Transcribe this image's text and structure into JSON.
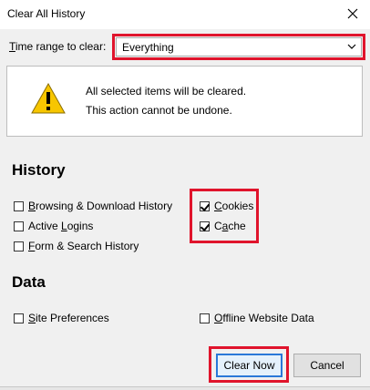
{
  "window": {
    "title": "Clear All History"
  },
  "time_range": {
    "label_prefix": "T",
    "label_rest": "ime range to clear:",
    "selected": "Everything"
  },
  "warning": {
    "line1": "All selected items will be cleared.",
    "line2": "This action cannot be undone."
  },
  "history": {
    "heading": "History",
    "items": [
      {
        "label": "Browsing & Download History",
        "accel": "B",
        "checked": false
      },
      {
        "label": "Active Logins",
        "accel": "L",
        "checked": false
      },
      {
        "label": "Form & Search History",
        "accel": "F",
        "checked": false
      },
      {
        "label": "Cookies",
        "accel": "C",
        "checked": true
      },
      {
        "label": "Cache",
        "accel": "a",
        "checked": true
      }
    ]
  },
  "data": {
    "heading": "Data",
    "items": [
      {
        "label": "Site Preferences",
        "accel": "S",
        "checked": false
      },
      {
        "label": "Offline Website Data",
        "accel": "O",
        "checked": false
      }
    ]
  },
  "buttons": {
    "clear_now": "Clear Now",
    "cancel": "Cancel"
  },
  "colors": {
    "highlight": "#e0142c",
    "default_button_border": "#2a78d8",
    "warning_yellow": "#f7c600"
  }
}
